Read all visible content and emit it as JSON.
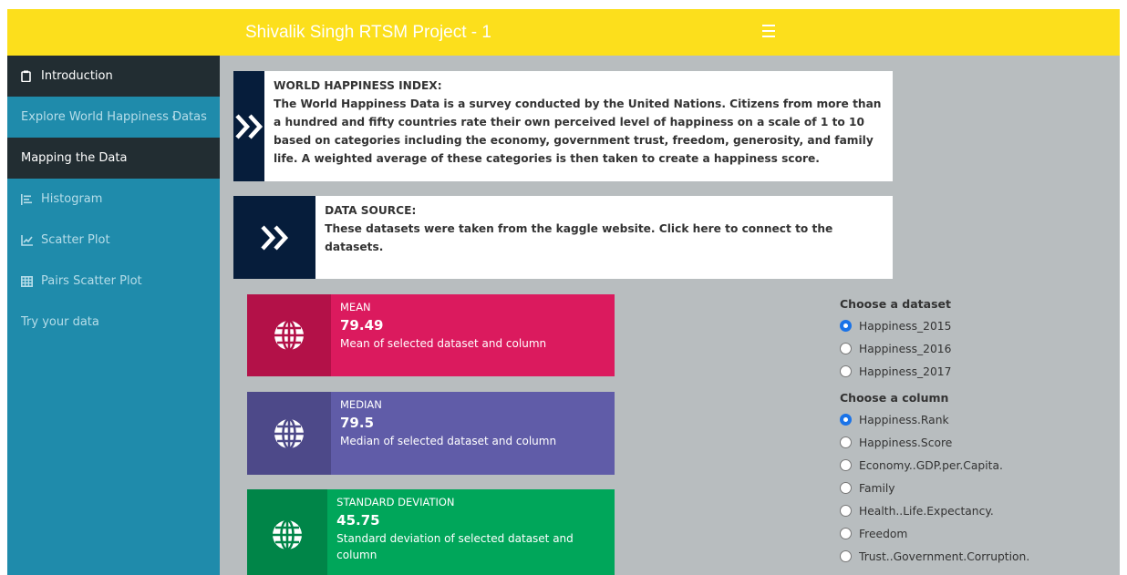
{
  "header": {
    "title": "Shivalik Singh RTSM Project - 1",
    "bg_color": "#fcdf1c"
  },
  "sidebar": {
    "items": [
      {
        "label": "Introduction",
        "icon": "clipboard-icon"
      },
      {
        "label": "Explore World Happiness Datas",
        "icon": "angle-left-icon"
      },
      {
        "label": "Mapping the Data",
        "icon": ""
      },
      {
        "label": "Histogram",
        "icon": "list-icon"
      },
      {
        "label": "Scatter Plot",
        "icon": "line-chart-icon"
      },
      {
        "label": "Pairs Scatter Plot",
        "icon": "table-icon"
      },
      {
        "label": "Try your data",
        "icon": ""
      }
    ]
  },
  "info_boxes": [
    {
      "title": "WORLD HAPPINESS INDEX:",
      "text": "The World Happiness Data is a survey conducted by the United Nations. Citizens from more than a hundred and fifty countries rate their own perceived level of happiness on a scale of 1 to 10 based on categories including the economy, government trust, freedom, generosity, and family life. A weighted average of these categories is then taken to create a happiness score.",
      "icon": "double-chevron-right-icon"
    },
    {
      "title": "DATA SOURCE:",
      "text": "These datasets were taken from the kaggle website. Click here to connect to the datasets.",
      "icon": "double-chevron-right-icon"
    }
  ],
  "stats": [
    {
      "title": "MEAN",
      "value": "79.49",
      "desc": "Mean of selected dataset and column",
      "color": "#db1a5e",
      "dark": "#b31148",
      "icon": "globe-icon"
    },
    {
      "title": "MEDIAN",
      "value": "79.5",
      "desc": "Median of selected dataset and column",
      "color": "#605ca8",
      "dark": "#4d4989",
      "icon": "globe-icon"
    },
    {
      "title": "STANDARD DEVIATION",
      "value": "45.75",
      "desc": "Standard deviation of selected dataset and column",
      "color": "#00a65a",
      "dark": "#008548",
      "icon": "globe-icon"
    }
  ],
  "controls": {
    "dataset_label": "Choose a dataset",
    "datasets": [
      "Happiness_2015",
      "Happiness_2016",
      "Happiness_2017"
    ],
    "selected_dataset": "Happiness_2015",
    "column_label": "Choose a column",
    "columns": [
      "Happiness.Rank",
      "Happiness.Score",
      "Economy..GDP.per.Capita.",
      "Family",
      "Health..Life.Expectancy.",
      "Freedom",
      "Trust..Government.Corruption."
    ],
    "selected_column": "Happiness.Rank"
  }
}
